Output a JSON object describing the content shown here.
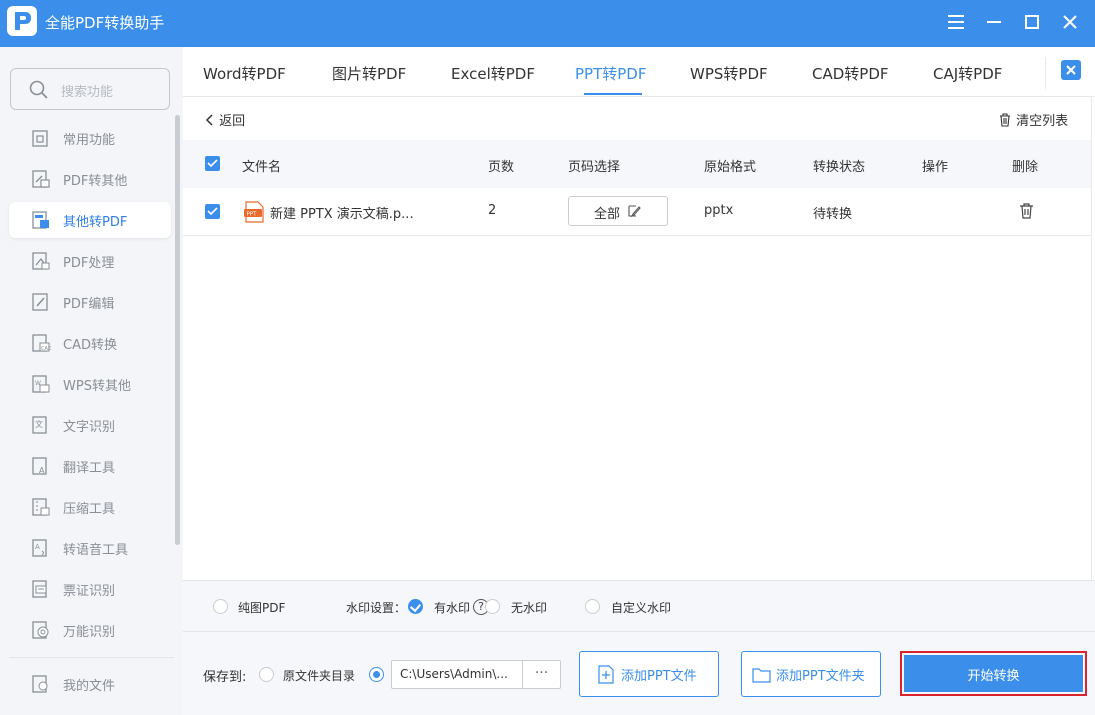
{
  "app": {
    "title": "全能PDF转换助手"
  },
  "window_controls": {
    "menu_icon": "menu-icon",
    "min_icon": "minimize-icon",
    "max_icon": "maximize-icon",
    "close_icon": "close-icon"
  },
  "sidebar": {
    "search_placeholder": "搜索功能",
    "items": [
      {
        "label": "常用功能",
        "icon": "common-icon",
        "active": false
      },
      {
        "label": "PDF转其他",
        "icon": "pdf-convert-icon",
        "active": false
      },
      {
        "label": "其他转PDF",
        "icon": "to-pdf-icon",
        "active": true
      },
      {
        "label": "PDF处理",
        "icon": "pdf-process-icon",
        "active": false
      },
      {
        "label": "PDF编辑",
        "icon": "pdf-edit-icon",
        "active": false
      },
      {
        "label": "CAD转换",
        "icon": "cad-icon",
        "active": false
      },
      {
        "label": "WPS转其他",
        "icon": "wps-icon",
        "active": false
      },
      {
        "label": "文字识别",
        "icon": "ocr-icon",
        "active": false
      },
      {
        "label": "翻译工具",
        "icon": "translate-icon",
        "active": false
      },
      {
        "label": "压缩工具",
        "icon": "compress-icon",
        "active": false
      },
      {
        "label": "转语音工具",
        "icon": "voice-icon",
        "active": false
      },
      {
        "label": "票证识别",
        "icon": "ticket-icon",
        "active": false
      },
      {
        "label": "万能识别",
        "icon": "universal-icon",
        "active": false
      }
    ],
    "my_files": "我的文件"
  },
  "tabs": [
    {
      "label": "Word转PDF"
    },
    {
      "label": "图片转PDF"
    },
    {
      "label": "Excel转PDF"
    },
    {
      "label": "PPT转PDF"
    },
    {
      "label": "WPS转PDF"
    },
    {
      "label": "CAD转PDF"
    },
    {
      "label": "CAJ转PDF"
    }
  ],
  "active_tab": "PPT转PDF",
  "toolbar": {
    "back": "返回",
    "clear": "清空列表"
  },
  "table": {
    "headers": {
      "filename": "文件名",
      "pages": "页数",
      "page_select": "页码选择",
      "format": "原始格式",
      "status": "转换状态",
      "action": "操作",
      "delete": "删除"
    },
    "rows": [
      {
        "filename": "新建 PPTX 演示文稿.p...",
        "file_badge": "PPT",
        "pages": "2",
        "page_select": "全部",
        "format": "pptx",
        "status": "待转换"
      }
    ]
  },
  "options": {
    "pure_pdf": "纯图PDF",
    "help": "?",
    "watermark_label": "水印设置：",
    "with_watermark": "有水印",
    "no_watermark": "无水印",
    "custom_watermark": "自定义水印"
  },
  "bottom": {
    "save_to": "保存到:",
    "source_dir": "原文件夹目录",
    "path": "C:\\Users\\Admin\\...",
    "dots": "···",
    "add_file": "添加PPT文件",
    "add_folder": "添加PPT文件夹",
    "start": "开始转换"
  },
  "colors": {
    "accent": "#3b8fea",
    "highlight_border": "#d9232e",
    "ppt_badge": "#e86b2c"
  }
}
